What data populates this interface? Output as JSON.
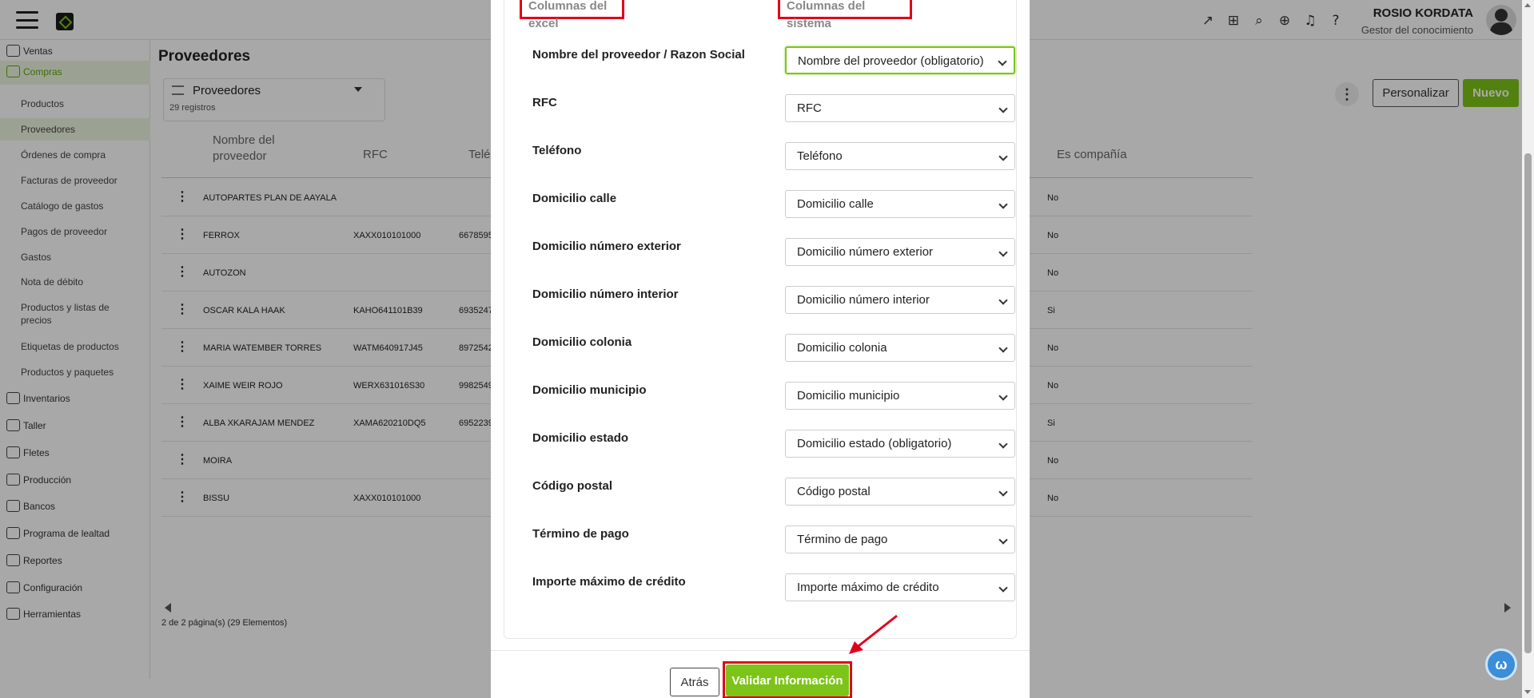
{
  "header": {
    "user_name": "ROSIO KORDATA",
    "user_role": "Gestor del conocimiento",
    "icons": [
      "external-link-icon",
      "gift-icon",
      "zoom-icon",
      "plus-circle-icon",
      "bell-icon",
      "help-icon"
    ]
  },
  "sidebar": {
    "ventas": "Ventas",
    "compras": "Compras",
    "sub": {
      "productos": "Productos",
      "proveedores": "Proveedores",
      "ordenes": "Órdenes de compra",
      "facturas": "Facturas de proveedor",
      "catalogo": "Catálogo de gastos",
      "pagos": "Pagos de proveedor",
      "gastos": "Gastos",
      "nota": "Nota de débito",
      "listas": "Productos y listas de precios",
      "etiquetas": "Etiquetas de productos",
      "paquetes": "Productos y paquetes"
    },
    "inventarios": "Inventarios",
    "taller": "Taller",
    "fletes": "Fletes",
    "produccion": "Producción",
    "bancos": "Bancos",
    "lealtad": "Programa de lealtad",
    "reportes": "Reportes",
    "configuracion": "Configuración",
    "herramientas": "Herramientas"
  },
  "main": {
    "title": "Proveedores",
    "view_name": "Proveedores",
    "record_count": "29 registros",
    "personalizar": "Personalizar",
    "nuevo": "Nuevo",
    "columns": {
      "nombre": "Nombre del proveedor",
      "rfc": "RFC",
      "telefono": "Telé",
      "es_compania": "Es compañía"
    },
    "rows": [
      {
        "nombre": "AUTOPARTES PLAN DE AAYALA",
        "rfc": "",
        "tel": "",
        "comp": "No"
      },
      {
        "nombre": "FERROX",
        "rfc": "XAXX010101000",
        "tel": "6678595",
        "comp": "No"
      },
      {
        "nombre": "AUTOZON",
        "rfc": "",
        "tel": "",
        "comp": "No"
      },
      {
        "nombre": "OSCAR KALA HAAK",
        "rfc": "KAHO641101B39",
        "tel": "6935247",
        "comp": "Si"
      },
      {
        "nombre": "MARIA WATEMBER TORRES",
        "rfc": "WATM640917J45",
        "tel": "8972542",
        "comp": "No"
      },
      {
        "nombre": "XAIME WEIR ROJO",
        "rfc": "WERX631016S30",
        "tel": "9982549",
        "comp": "No"
      },
      {
        "nombre": "ALBA XKARAJAM MENDEZ",
        "rfc": "XAMA620210DQ5",
        "tel": "6952239",
        "comp": "Si"
      },
      {
        "nombre": "MOIRA",
        "rfc": "",
        "tel": "",
        "comp": "No"
      },
      {
        "nombre": "BISSU",
        "rfc": "XAXX010101000",
        "tel": "",
        "comp": "No"
      }
    ],
    "pagination": "2 de 2 página(s) (29 Elementos)"
  },
  "modal": {
    "excel_header": "Columnas del excel",
    "system_header": "Columnas del sistema",
    "mappings": [
      {
        "excel": "Nombre del proveedor / Razon Social",
        "system": "Nombre del proveedor (obligatorio)"
      },
      {
        "excel": "RFC",
        "system": "RFC"
      },
      {
        "excel": "Teléfono",
        "system": "Teléfono"
      },
      {
        "excel": "Domicilio calle",
        "system": "Domicilio calle"
      },
      {
        "excel": "Domicilio número exterior",
        "system": "Domicilio número exterior"
      },
      {
        "excel": "Domicilio número interior",
        "system": "Domicilio número interior"
      },
      {
        "excel": "Domicilio colonia",
        "system": "Domicilio colonia"
      },
      {
        "excel": "Domicilio municipio",
        "system": "Domicilio municipio"
      },
      {
        "excel": "Domicilio estado",
        "system": "Domicilio estado (obligatorio)"
      },
      {
        "excel": "Código postal",
        "system": "Código postal"
      },
      {
        "excel": "Término de pago",
        "system": "Término de pago"
      },
      {
        "excel": "Importe máximo de crédito",
        "system": "Importe máximo de crédito"
      }
    ],
    "back_label": "Atrás",
    "validate_label": "Validar Información"
  },
  "colors": {
    "accent": "#7dc418",
    "highlight_red": "#e0001b"
  }
}
